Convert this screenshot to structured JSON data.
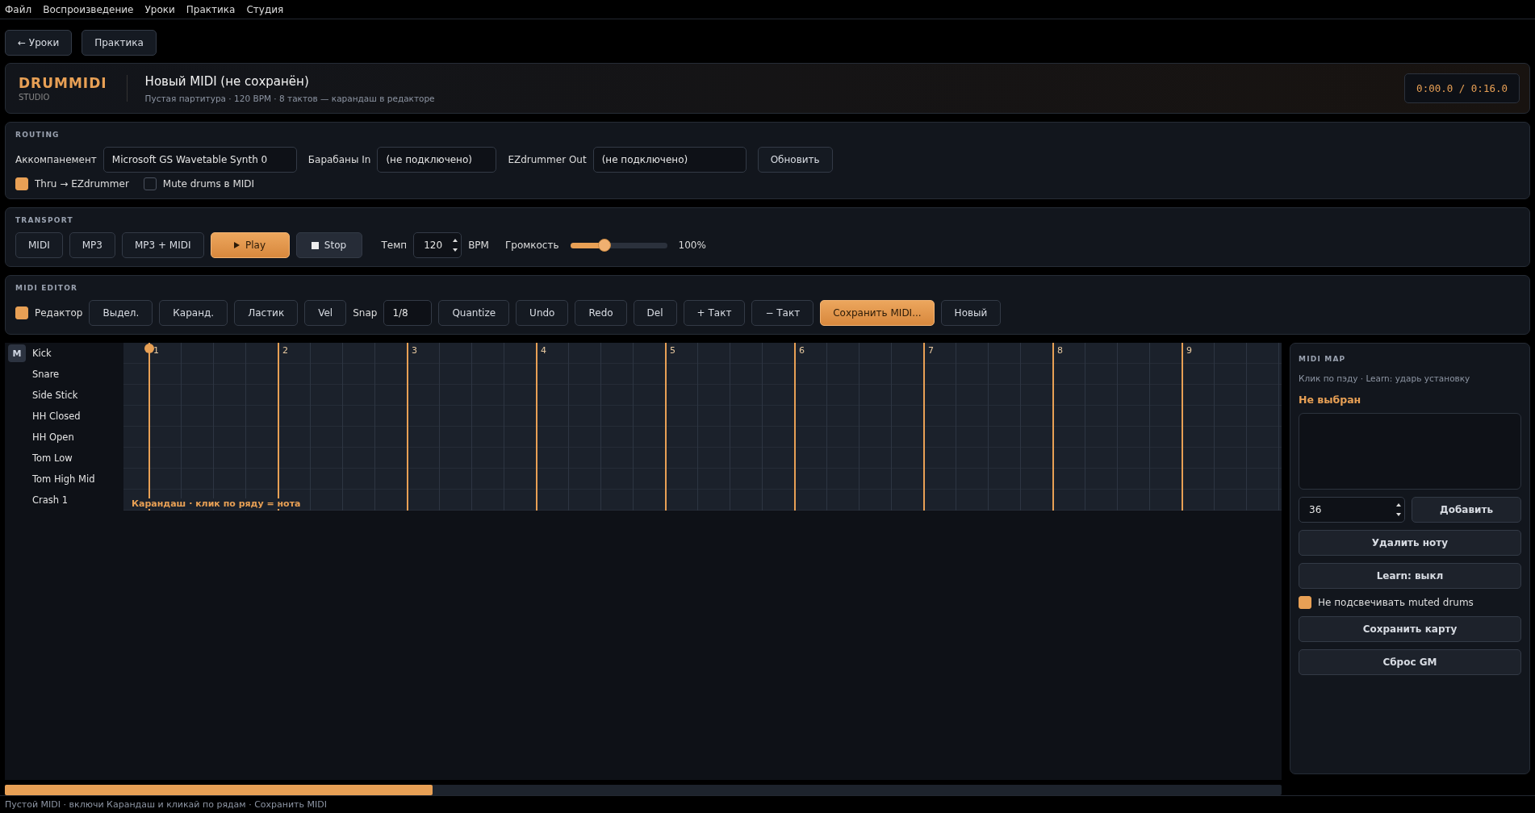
{
  "menu": [
    "Файл",
    "Воспроизведение",
    "Уроки",
    "Практика",
    "Студия"
  ],
  "nav_buttons": [
    "← Уроки",
    "Практика"
  ],
  "header": {
    "logo": "DRUMMIDI",
    "logo_sub": "STUDIO",
    "title": "Новый MIDI (не сохранён)",
    "subtitle": "Пустая партитура · 120 BPM · 8 тактов — карандаш в редакторе",
    "time": "0:00.0 / 0:16.0"
  },
  "routing": {
    "title": "ROUTING",
    "fields": [
      {
        "label": "Аккомпанемент",
        "value": "Microsoft GS Wavetable Synth 0"
      },
      {
        "label": "Барабаны In",
        "value": "(не подключено)"
      },
      {
        "label": "EZdrummer Out",
        "value": "(не подключено)"
      }
    ],
    "refresh": "Обновить",
    "checks": [
      {
        "label": "Thru → EZdrummer",
        "checked": true
      },
      {
        "label": "Mute drums в MIDI",
        "checked": false
      }
    ]
  },
  "transport": {
    "title": "TRANSPORT",
    "formats": [
      "MIDI",
      "MP3",
      "MP3 + MIDI"
    ],
    "play": "Play",
    "stop": "Stop",
    "tempo_label": "Темп",
    "tempo": "120",
    "tempo_unit": "BPM",
    "volume_label": "Громкость",
    "volume": {
      "level": 0.35,
      "reading": "100%"
    }
  },
  "editor": {
    "title": "MIDI EDITOR",
    "toggle": {
      "label": "Редактор",
      "checked": true
    },
    "items": [
      {
        "kind": "button",
        "label": "Выдел."
      },
      {
        "kind": "button",
        "label": "Каранд."
      },
      {
        "kind": "button",
        "label": "Ластик"
      },
      {
        "kind": "button",
        "label": "Vel"
      },
      {
        "kind": "label",
        "label": "Snap"
      },
      {
        "kind": "field",
        "label": "1/8"
      },
      {
        "kind": "button",
        "label": "Quantize"
      },
      {
        "kind": "button",
        "label": "Undo"
      },
      {
        "kind": "button",
        "label": "Redo"
      },
      {
        "kind": "button",
        "label": "Del"
      },
      {
        "kind": "button",
        "label": "+ Такт"
      },
      {
        "kind": "button",
        "label": "− Такт"
      },
      {
        "kind": "primary",
        "label": "Сохранить MIDI..."
      },
      {
        "kind": "button",
        "label": "Новый"
      }
    ]
  },
  "roll": {
    "lanes": [
      {
        "name": "Kick",
        "badge": "M"
      },
      {
        "name": "Snare"
      },
      {
        "name": "Side Stick"
      },
      {
        "name": "HH Closed"
      },
      {
        "name": "HH Open"
      },
      {
        "name": "Tom Low"
      },
      {
        "name": "Tom High Mid"
      },
      {
        "name": "Crash 1"
      }
    ],
    "bars": [
      "1",
      "2",
      "3",
      "4",
      "5",
      "6",
      "7",
      "8",
      "9"
    ],
    "hint": "Карандаш · клик по ряду = нота"
  },
  "midi_map": {
    "title": "MIDI MAP",
    "hint": "Клик по пэду · Learn: ударь установку",
    "selection": "Не выбран",
    "note": "36",
    "add": "Добавить",
    "buttons": [
      "Удалить ноту",
      "Learn: выкл"
    ],
    "check": {
      "label": "Не подсвечивать muted drums",
      "checked": true
    },
    "bottom_buttons": [
      "Сохранить карту",
      "Сброс GM"
    ]
  },
  "status_bar": "Пустой MIDI · включи Карандаш и кликай по рядам · Сохранить MIDI"
}
